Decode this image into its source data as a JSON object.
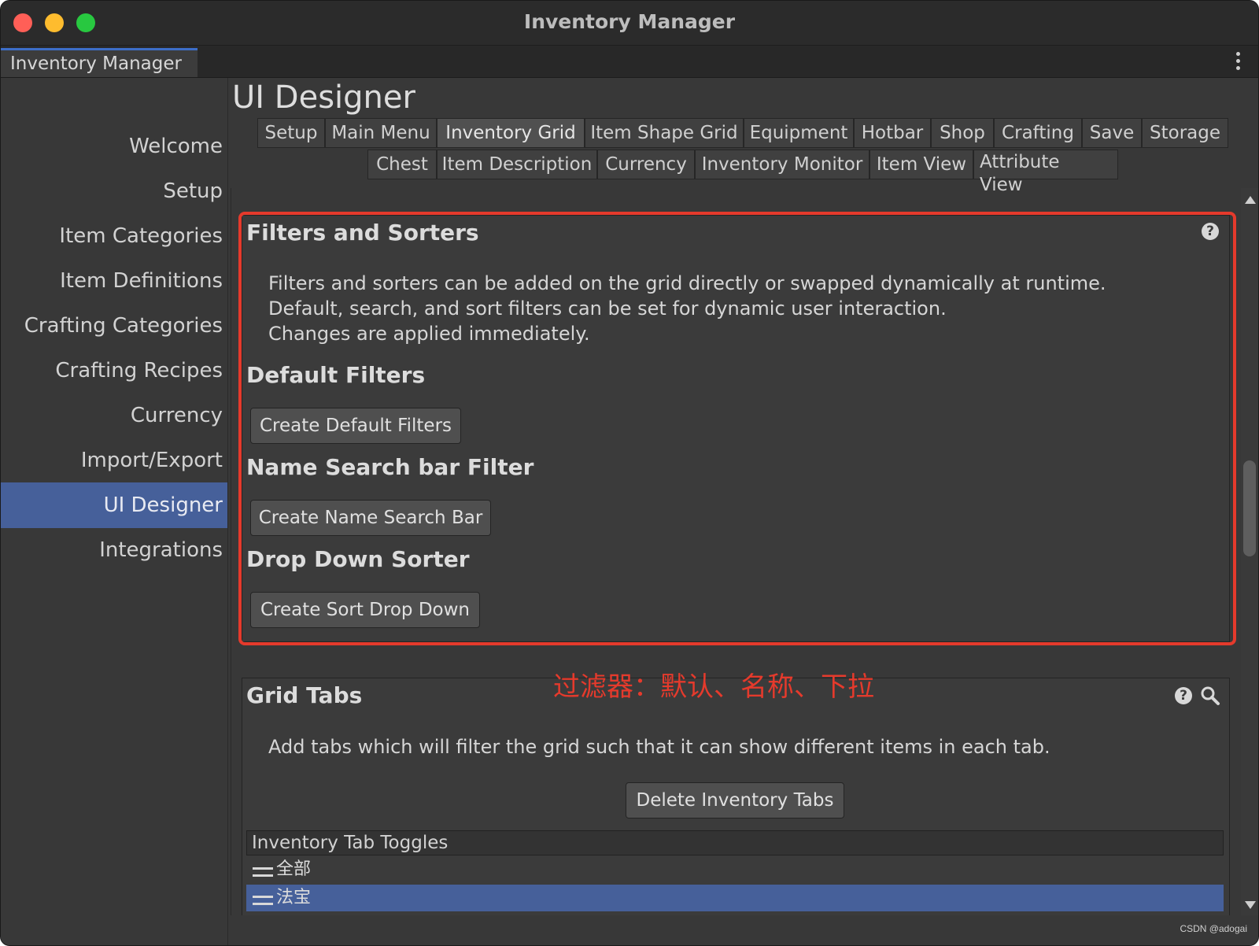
{
  "window": {
    "title": "Inventory Manager",
    "tab_label": "Inventory Manager"
  },
  "sidebar": {
    "items": [
      {
        "label": "Welcome"
      },
      {
        "label": "Setup"
      },
      {
        "label": "Item Categories"
      },
      {
        "label": "Item Definitions"
      },
      {
        "label": "Crafting Categories"
      },
      {
        "label": "Crafting Recipes"
      },
      {
        "label": "Currency"
      },
      {
        "label": "Import/Export"
      },
      {
        "label": "UI Designer",
        "selected": true
      },
      {
        "label": "Integrations"
      }
    ]
  },
  "main": {
    "title": "UI Designer",
    "tabs_row1": [
      "Setup",
      "Main Menu",
      "Inventory Grid",
      "Item Shape Grid",
      "Equipment",
      "Hotbar",
      "Shop",
      "Crafting",
      "Save",
      "Storage"
    ],
    "tabs_row2": [
      "Chest",
      "Item Description",
      "Currency",
      "Inventory Monitor",
      "Item View",
      "Attribute View"
    ],
    "active_tab": "Inventory Grid"
  },
  "filters_panel": {
    "title": "Filters and Sorters",
    "help_icon": "?",
    "description": [
      "Filters and sorters can be added on the grid directly or swapped dynamically at runtime.",
      "Default, search, and sort filters can be set for dynamic user interaction.",
      "Changes are applied immediately."
    ],
    "sections": [
      {
        "heading": "Default Filters",
        "button": "Create Default Filters"
      },
      {
        "heading": "Name Search bar Filter",
        "button": "Create Name Search Bar"
      },
      {
        "heading": "Drop Down Sorter",
        "button": "Create Sort Drop Down"
      }
    ]
  },
  "annotation": {
    "text": "过滤器：默认、名称、下拉",
    "color": "#e53a2c"
  },
  "grid_tabs_panel": {
    "title": "Grid Tabs",
    "help_icon": "?",
    "description": "Add tabs which will filter the grid such that it can show different items in each tab.",
    "delete_button": "Delete Inventory Tabs",
    "list_header": "Inventory Tab Toggles",
    "items": [
      {
        "label": "全部"
      },
      {
        "label": "法宝",
        "selected": true
      }
    ]
  },
  "watermark": "CSDN @adogai",
  "colors": {
    "selection": "#46609a",
    "window_tab_accent": "#3d6ec8",
    "highlight": "#e53a2c"
  }
}
